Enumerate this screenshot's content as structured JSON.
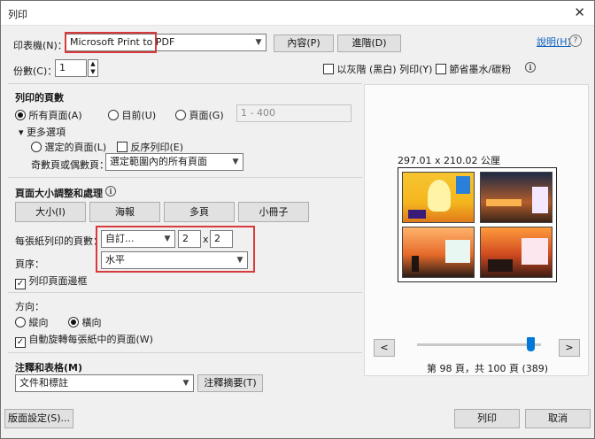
{
  "window": {
    "title": "列印",
    "close_glyph": "✕"
  },
  "printer": {
    "label": "印表機(N)：",
    "value": "Microsoft Print to PDF",
    "properties_button": "內容(P)",
    "advanced_button": "進階(D)",
    "help_link": "說明(H)"
  },
  "copies": {
    "label": "份數(C)：",
    "value": "1",
    "grayscale_label": "以灰階 (黑白) 列印(Y)",
    "save_ink_label": "節省墨水/碳粉"
  },
  "pages": {
    "title": "列印的頁數",
    "all_pages": "所有頁面(A)",
    "current": "目前(U)",
    "pages": "頁面(G)",
    "pages_range": "1 - 400",
    "more_options": "更多選項",
    "selected_pages": "選定的頁面(L)",
    "reverse": "反序列印(E)",
    "odd_even_label": "奇數頁或偶數頁：",
    "odd_even_value": "選定範圍內的所有頁面"
  },
  "sizing": {
    "title": "頁面大小調整和處理",
    "tabs": [
      "大小(I)",
      "海報",
      "多頁",
      "小冊子"
    ],
    "pages_per_sheet_label": "每張紙列印的頁數：",
    "pages_per_sheet_value": "自訂...",
    "grid_cols": "2",
    "grid_x": "x",
    "grid_rows": "2",
    "order_label": "頁序：",
    "order_value": "水平",
    "print_border": "列印頁面邊框"
  },
  "orientation": {
    "title": "方向：",
    "portrait": "縱向",
    "landscape": "橫向",
    "auto_rotate": "自動旋轉每張紙中的頁面(W)"
  },
  "comments": {
    "title": "注釋和表格(M)",
    "value": "文件和標註",
    "summarize_button": "注釋摘要(T)"
  },
  "preview": {
    "size_text": "297.01 x 210.02 公厘",
    "page_info": "第 98 頁，共 100 頁 (389)",
    "prev": "<",
    "next": ">"
  },
  "footer": {
    "page_setup": "版面設定(S)...",
    "print": "列印",
    "cancel": "取消"
  },
  "colors": {
    "highlight": "#d83b3b",
    "slider": "#0078d7",
    "link": "#0b5fbf"
  }
}
